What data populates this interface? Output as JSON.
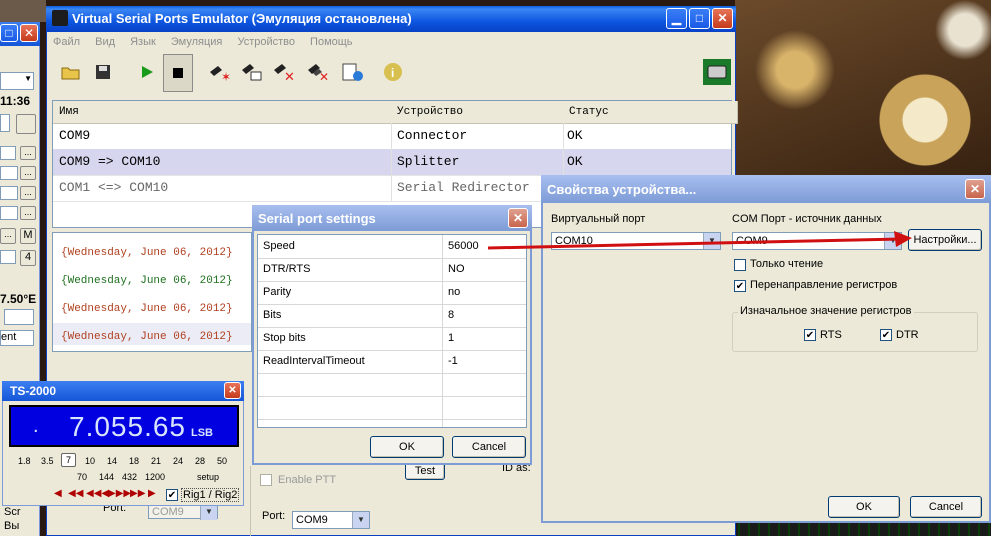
{
  "main_window": {
    "title": "Virtual Serial Ports Emulator (Эмуляция остановлена)",
    "menu": [
      "Файл",
      "Вид",
      "Язык",
      "Эмуляция",
      "Устройство",
      "Помощь"
    ],
    "columns": [
      "Имя",
      "Устройство",
      "Статус"
    ],
    "rows": [
      {
        "name": "COM9",
        "device": "Connector",
        "status": "OK",
        "selected": false
      },
      {
        "name": "COM9 => COM10",
        "device": "Splitter",
        "status": "OK",
        "selected": true
      },
      {
        "name": "COM1 <=> COM10",
        "device": "Serial Redirector",
        "status": "",
        "selected": false
      }
    ],
    "log": [
      {
        "text": "{Wednesday, June 06, 2012}",
        "color": "#b04020"
      },
      {
        "text": "{Wednesday, June 06, 2012}",
        "color": "#207020"
      },
      {
        "text": "{Wednesday, June 06, 2012}",
        "color": "#b04020"
      },
      {
        "text": "{Wednesday, June 06, 2012}",
        "color": "#b04020"
      }
    ],
    "bottom": {
      "enable_ptt": "Enable PTT",
      "port_label": "Port:",
      "port_value": "COM9",
      "left_port_label": "Port:",
      "left_port_value": "COM9",
      "test_button": "Test",
      "id_as": "ID as:"
    }
  },
  "serial_settings": {
    "title": "Serial port settings",
    "rows": [
      {
        "key": "Speed",
        "value": "56000"
      },
      {
        "key": "DTR/RTS",
        "value": "NO"
      },
      {
        "key": "Parity",
        "value": "no"
      },
      {
        "key": "Bits",
        "value": "8"
      },
      {
        "key": "Stop bits",
        "value": "1"
      },
      {
        "key": "ReadIntervalTimeout",
        "value": "-1"
      }
    ],
    "ok": "OK",
    "cancel": "Cancel"
  },
  "props": {
    "title": "Свойства устройства...",
    "virtual_port_label": "Виртуальный порт",
    "virtual_port_value": "COM10",
    "source_label": "COM Порт - источник данных",
    "source_value": "COM9",
    "settings_button": "Настройки...",
    "readonly_label": "Только чтение",
    "readonly_checked": false,
    "regredirect_label": "Перенаправление регистров",
    "regredirect_checked": true,
    "group_label": "Изначальное значение регистров",
    "rts_label": "RTS",
    "rts_checked": true,
    "dtr_label": "DTR",
    "dtr_checked": true,
    "ok": "OK",
    "cancel": "Cancel"
  },
  "left_panel": {
    "time": "11:36",
    "temp": "7.50°E",
    "dropdown": "ent",
    "labels": [
      "M",
      "4",
      "Scr",
      "Вы"
    ]
  },
  "ts2000": {
    "title": "TS-2000",
    "freq": "7.055.65",
    "mode": "LSB",
    "bands_row1": [
      "1.8",
      "3.5",
      "7",
      "10",
      "14",
      "18",
      "21",
      "24",
      "28",
      "50"
    ],
    "bands_row2": [
      "70",
      "144",
      "432",
      "1200",
      "setup"
    ],
    "rig_label": "Rig1 / Rig2",
    "rig_checked": true
  },
  "colors": {
    "xp_blue": "#0c56e0",
    "selected_row": "#d6d6ee",
    "annotation_arrow": "#d01010"
  }
}
